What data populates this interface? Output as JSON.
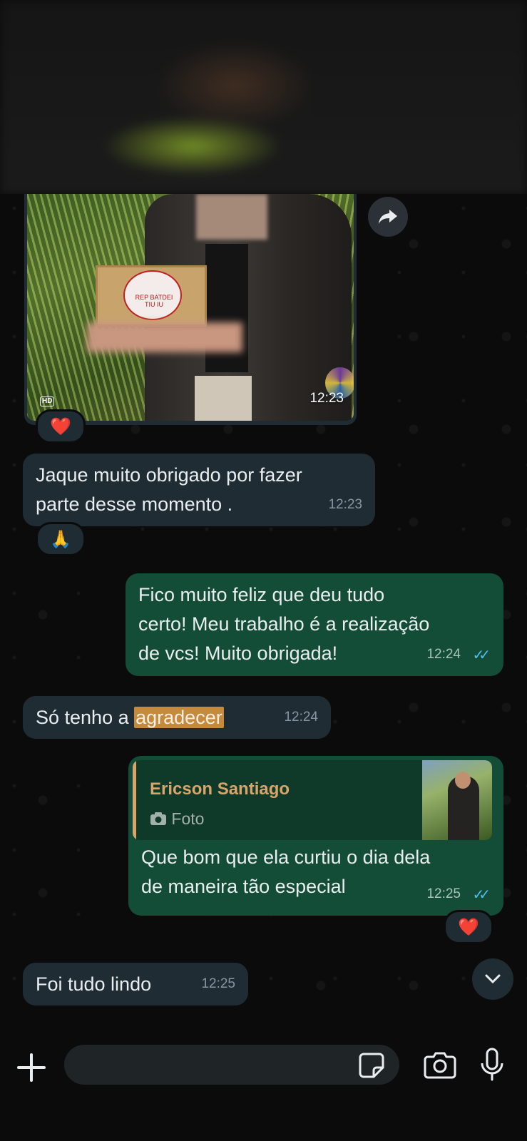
{
  "photo_message": {
    "badge": "HD",
    "time": "12:23",
    "cake_text": "REP BATDEI TIU IU",
    "reaction": "❤️"
  },
  "messages": [
    {
      "dir": "in",
      "text_lines": [
        "Jaque muito obrigado por fazer",
        "parte desse momento ."
      ],
      "time": "12:23",
      "reaction": "🙏"
    },
    {
      "dir": "out",
      "text_lines": [
        "Fico muito feliz que deu tudo",
        "certo! Meu trabalho é a realização",
        "de vcs! Muito obrigada!"
      ],
      "time": "12:24",
      "status": "read"
    },
    {
      "dir": "in",
      "text_prefix": "Só tenho a ",
      "text_highlight": "agradecer",
      "time": "12:24"
    },
    {
      "dir": "out",
      "quote": {
        "name": "Ericson Santiago",
        "type": "Foto"
      },
      "text_lines": [
        "Que bom que ela curtiu o dia dela",
        "de maneira tão especial"
      ],
      "time": "12:25",
      "status": "read",
      "reaction": "❤️"
    },
    {
      "dir": "in",
      "text": "Foi tudo lindo",
      "time": "12:25"
    }
  ],
  "icons": {
    "forward": "forward-arrow-icon",
    "scroll": "chevron-down-icon",
    "attach": "plus-icon",
    "sticker": "sticker-icon",
    "camera": "camera-icon",
    "mic": "microphone-icon"
  },
  "composer": {
    "placeholder": ""
  },
  "colors": {
    "incoming": "#1f2c33",
    "outgoing": "#144d37",
    "read_ticks": "#53bdeb",
    "quote_name": "#d9a56a"
  }
}
